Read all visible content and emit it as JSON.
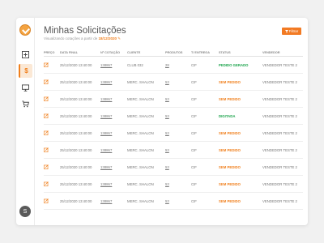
{
  "sidebar": {
    "items": [
      {
        "name": "sidebar-item-plus",
        "glyph": "+"
      },
      {
        "name": "sidebar-item-dollar",
        "glyph": "$"
      },
      {
        "name": "sidebar-item-monitor",
        "glyph": ""
      },
      {
        "name": "sidebar-item-cart",
        "glyph": ""
      }
    ],
    "avatar_initial": "S"
  },
  "header": {
    "title": "Minhas Solicitações",
    "subtitle_prefix": "Visualizando cotações a partir de",
    "subtitle_date": "18/12/2020",
    "filter_label": "Filtrar"
  },
  "table": {
    "columns": [
      "PREÇO",
      "DATA FINAL",
      "Nº COTAÇÃO",
      "CLIENTE",
      "PRODUTOS",
      "T/ ENTREGA",
      "STATUS",
      "VENDEDOR"
    ],
    "rows": [
      {
        "date": "25/12/2020 13:40:00",
        "quote": "138867",
        "client": "CLUB 032",
        "products": "28",
        "delivery": "CIF",
        "status": "PEDIDO GERADO",
        "status_color": "#1aa34a",
        "seller": "VENDEDOR TESTE 2"
      },
      {
        "date": "25/12/2020 13:40:00",
        "quote": "138867",
        "client": "MERC. SHALON",
        "products": "53",
        "delivery": "CIF",
        "status": "SEM PEDIDO",
        "status_color": "#f07f1c",
        "seller": "VENDEDOR TESTE 2"
      },
      {
        "date": "25/12/2020 13:40:00",
        "quote": "138867",
        "client": "MERC. SHALON",
        "products": "53",
        "delivery": "CIF",
        "status": "SEM PEDIDO",
        "status_color": "#f07f1c",
        "seller": "VENDEDOR TESTE 2"
      },
      {
        "date": "25/12/2020 13:40:00",
        "quote": "138867",
        "client": "MERC. SHALON",
        "products": "53",
        "delivery": "CIF",
        "status": "DIGITADA",
        "status_color": "#1aa34a",
        "seller": "VENDEDOR TESTE 2"
      },
      {
        "date": "25/12/2020 13:40:00",
        "quote": "138867",
        "client": "MERC. SHALON",
        "products": "53",
        "delivery": "CIF",
        "status": "SEM PEDIDO",
        "status_color": "#f07f1c",
        "seller": "VENDEDOR TESTE 2"
      },
      {
        "date": "25/12/2020 13:40:00",
        "quote": "138867",
        "client": "MERC. SHALON",
        "products": "53",
        "delivery": "CIF",
        "status": "SEM PEDIDO",
        "status_color": "#f07f1c",
        "seller": "VENDEDOR TESTE 2"
      },
      {
        "date": "25/12/2020 13:40:00",
        "quote": "138867",
        "client": "MERC. SHALON",
        "products": "53",
        "delivery": "CIF",
        "status": "SEM PEDIDO",
        "status_color": "#f07f1c",
        "seller": "VENDEDOR TESTE 2"
      },
      {
        "date": "25/12/2020 13:40:00",
        "quote": "138867",
        "client": "MERC. SHALON",
        "products": "53",
        "delivery": "CIF",
        "status": "SEM PEDIDO",
        "status_color": "#f07f1c",
        "seller": "VENDEDOR TESTE 2"
      },
      {
        "date": "25/12/2020 13:40:00",
        "quote": "138867",
        "client": "MERC. SHALON",
        "products": "53",
        "delivery": "CIF",
        "status": "SEM PEDIDO",
        "status_color": "#f07f1c",
        "seller": "VENDEDOR TESTE 2"
      }
    ]
  },
  "colors": {
    "accent": "#f27a23",
    "status_green": "#1aa34a",
    "status_orange": "#f07f1c"
  }
}
